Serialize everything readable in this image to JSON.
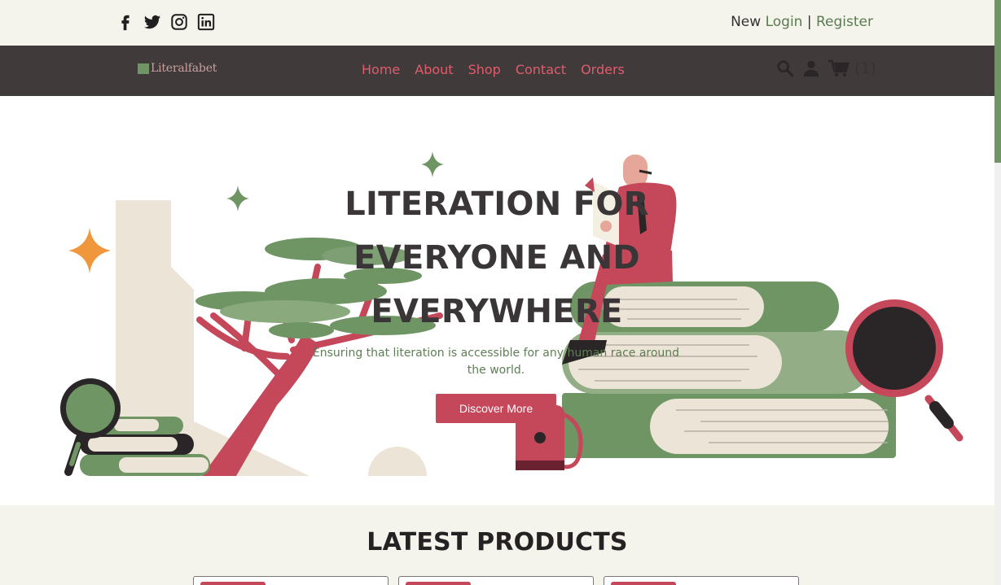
{
  "top_bar": {
    "social_icons": [
      "facebook-icon",
      "twitter-icon",
      "instagram-icon",
      "linkedin-icon"
    ],
    "auth_prefix": "New",
    "login": "Login",
    "separator": "|",
    "register": "Register"
  },
  "navbar": {
    "brand": "Literalfabet",
    "menu": [
      "Home",
      "About",
      "Shop",
      "Contact",
      "Orders"
    ],
    "tool_icons": [
      "search-icon",
      "user-icon",
      "cart-icon"
    ],
    "cart_count": "(1)"
  },
  "hero": {
    "title": "LITERATION FOR EVERYONE AND EVERYWHERE",
    "subtitle": "Ensuring that literation is accessible for any human race around the world.",
    "cta": "Discover More"
  },
  "products": {
    "heading": "LATEST PRODUCTS"
  },
  "colors": {
    "accent_green": "#6f9565",
    "accent_red": "#c4475a",
    "nav_bg": "#403a3b",
    "cream": "#f5f4ec",
    "orange": "#f0963c"
  }
}
